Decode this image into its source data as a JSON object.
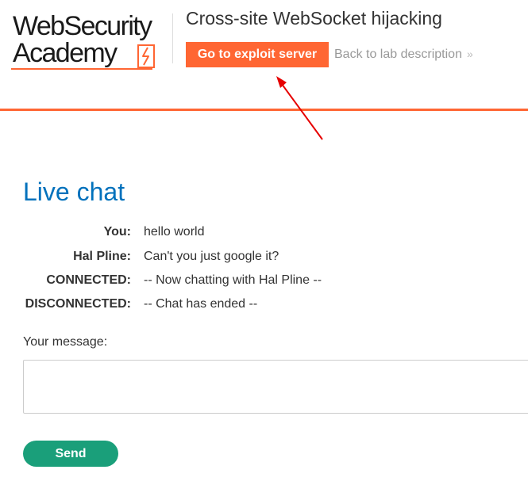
{
  "logo": {
    "line1": "WebSecurity",
    "line2": "Academy",
    "accent_color": "#ff6633"
  },
  "header": {
    "lab_title": "Cross-site WebSocket hijacking",
    "exploit_button_label": "Go to exploit server",
    "back_link_label": "Back to lab description",
    "back_link_icon": "double-chevron-right-icon",
    "annotation_icon": "arrow-pointing-to-exploit-button"
  },
  "chat": {
    "title": "Live chat",
    "messages": [
      {
        "speaker": "You:",
        "text": "hello world"
      },
      {
        "speaker": "Hal Pline:",
        "text": "Can't you just google it?"
      },
      {
        "speaker": "CONNECTED:",
        "text": "-- Now chatting with Hal Pline --"
      },
      {
        "speaker": "DISCONNECTED:",
        "text": "-- Chat has ended --"
      }
    ],
    "message_label": "Your message:",
    "message_value": "",
    "send_label": "Send"
  },
  "colors": {
    "title_blue": "#0071bc",
    "send_green": "#1a9f7a",
    "orange": "#ff6633",
    "annotation_red": "#e60000"
  }
}
